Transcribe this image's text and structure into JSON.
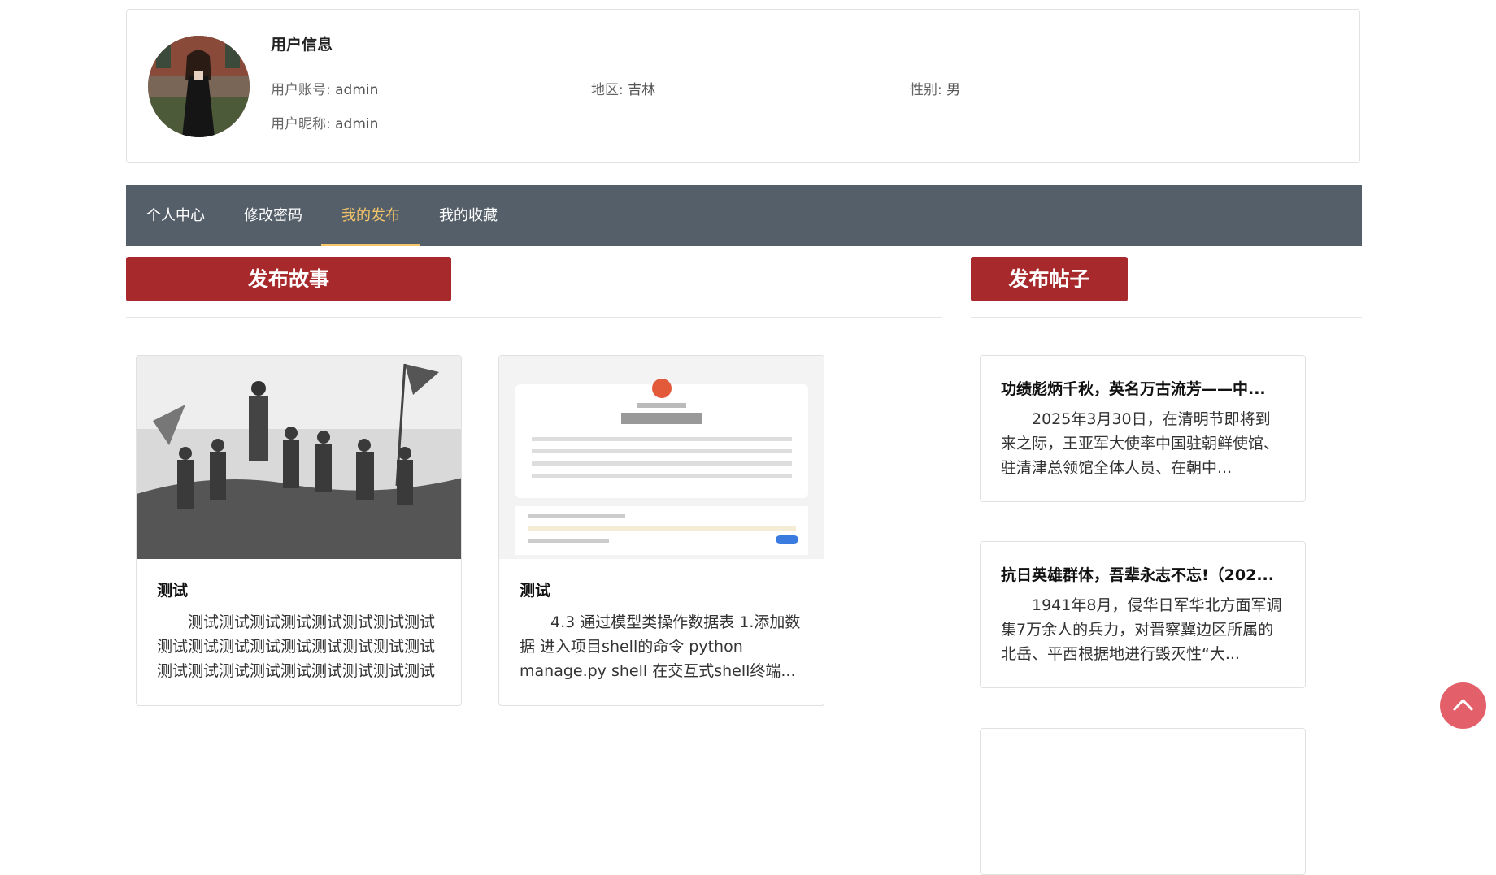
{
  "user": {
    "title": "用户信息",
    "account_label": "用户账号:",
    "account_value": "admin",
    "region_label": "地区:",
    "region_value": "吉林",
    "gender_label": "性别:",
    "gender_value": "男",
    "nickname_label": "用户昵称:",
    "nickname_value": "admin"
  },
  "nav": {
    "items": [
      "个人中心",
      "修改密码",
      "我的发布",
      "我的收藏"
    ],
    "active": "我的发布"
  },
  "actions": {
    "publish_story": "发布故事",
    "publish_post": "发布帖子"
  },
  "stories": [
    {
      "title": "测试",
      "desc": "测试测试测试测试测试测试测试测试测试测试测试测试测试测试测试测试测试测试测试测试测试测试测试测试测试测试测试测试测试..."
    },
    {
      "title": "测试",
      "desc": "4.3 通过模型类操作数据表 1.添加数据 进入项目shell的命令 python manage.py shell 在交互式shell终端..."
    }
  ],
  "posts": [
    {
      "title": "功绩彪炳千秋，英名万古流芳——中...",
      "desc": "2025年3月30日，在清明节即将到来之际，王亚军大使率中国驻朝鲜使馆、驻清津总领馆全体人员、在朝中..."
    },
    {
      "title": "抗日英雄群体，吾辈永志不忘!（202...",
      "desc": "1941年8月，侵华日军华北方面军调集7万余人的兵力，对晋察冀边区所属的北岳、平西根据地进行毁灭性“大..."
    }
  ],
  "colors": {
    "nav_bg": "#555f69",
    "nav_active": "#f5c56a",
    "button_red": "#a8292b",
    "fab": "#e3606a"
  }
}
